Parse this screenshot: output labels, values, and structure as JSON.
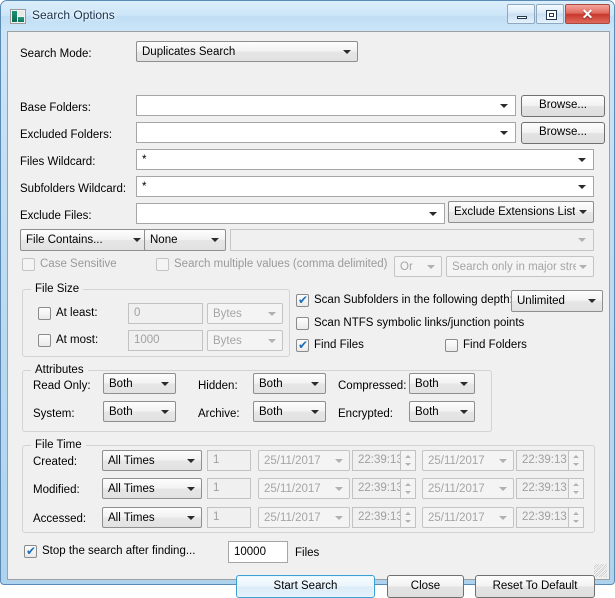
{
  "window": {
    "title": "Search Options",
    "icon": "app-icon",
    "minimize": "minimize-icon",
    "maximize": "maximize-icon",
    "close": "✕"
  },
  "colors": {
    "accent": "#3c9fd4",
    "title_text": "#16324f",
    "close_button": "#c9382c",
    "check_mark": "#1d6fbd",
    "client_bg": "#f0f0f0"
  },
  "form": {
    "search_mode": {
      "label": "Search Mode:",
      "value": "Duplicates Search"
    },
    "base_folders": {
      "label": "Base Folders:",
      "value": "",
      "browse": "Browse..."
    },
    "excluded_folders": {
      "label": "Excluded Folders:",
      "value": "",
      "browse": "Browse..."
    },
    "files_wildcard": {
      "label": "Files Wildcard:",
      "value": "*"
    },
    "subfolders_wildcard": {
      "label": "Subfolders Wildcard:",
      "value": "*"
    },
    "exclude_files": {
      "label": "Exclude Files:",
      "value": "",
      "extensions_button": "Exclude Extensions List"
    },
    "content": {
      "mode": "File Contains...",
      "match": "None",
      "text": "",
      "case_sensitive": {
        "label": "Case Sensitive",
        "checked": false,
        "enabled": false
      },
      "multi_values": {
        "label": "Search multiple values (comma delimited)",
        "checked": false,
        "enabled": false
      },
      "operator": "Or",
      "stream_scope": "Search only in major stre"
    }
  },
  "file_size": {
    "title": "File Size",
    "at_least": {
      "label": "At least:",
      "checked": false,
      "value": "0",
      "unit": "Bytes"
    },
    "at_most": {
      "label": "At most:",
      "checked": false,
      "value": "1000",
      "unit": "Bytes"
    }
  },
  "scan_options": {
    "scan_subfolders": {
      "label": "Scan Subfolders in the following depth:",
      "checked": true
    },
    "depth": "Unlimited",
    "scan_ntfs": {
      "label": "Scan NTFS symbolic links/junction points",
      "checked": false
    },
    "find_files": {
      "label": "Find Files",
      "checked": true
    },
    "find_folders": {
      "label": "Find Folders",
      "checked": false
    }
  },
  "attributes": {
    "title": "Attributes",
    "rows": [
      {
        "label": "Read Only:",
        "value": "Both"
      },
      {
        "label": "Hidden:",
        "value": "Both"
      },
      {
        "label": "Compressed:",
        "value": "Both"
      },
      {
        "label": "System:",
        "value": "Both"
      },
      {
        "label": "Archive:",
        "value": "Both"
      },
      {
        "label": "Encrypted:",
        "value": "Both"
      }
    ]
  },
  "file_time": {
    "title": "File Time",
    "rows": [
      {
        "label": "Created:",
        "mode": "All Times",
        "amount": "1",
        "date1": "25/11/2017",
        "time1": "22:39:13",
        "date2": "25/11/2017",
        "time2": "22:39:13"
      },
      {
        "label": "Modified:",
        "mode": "All Times",
        "amount": "1",
        "date1": "25/11/2017",
        "time1": "22:39:13",
        "date2": "25/11/2017",
        "time2": "22:39:13"
      },
      {
        "label": "Accessed:",
        "mode": "All Times",
        "amount": "1",
        "date1": "25/11/2017",
        "time1": "22:39:13",
        "date2": "25/11/2017",
        "time2": "22:39:13"
      }
    ]
  },
  "footer": {
    "stop_after": {
      "label": "Stop the search after finding...",
      "checked": true
    },
    "stop_count": "10000",
    "files_label": "Files",
    "start_search": "Start Search",
    "close": "Close",
    "reset": "Reset To Default"
  }
}
